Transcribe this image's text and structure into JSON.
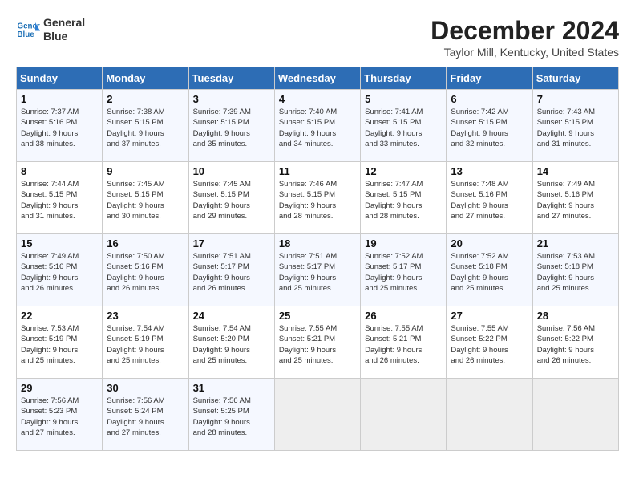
{
  "header": {
    "logo_line1": "General",
    "logo_line2": "Blue",
    "title": "December 2024",
    "subtitle": "Taylor Mill, Kentucky, United States"
  },
  "columns": [
    "Sunday",
    "Monday",
    "Tuesday",
    "Wednesday",
    "Thursday",
    "Friday",
    "Saturday"
  ],
  "weeks": [
    [
      {
        "day": "1",
        "info": "Sunrise: 7:37 AM\nSunset: 5:16 PM\nDaylight: 9 hours\nand 38 minutes."
      },
      {
        "day": "2",
        "info": "Sunrise: 7:38 AM\nSunset: 5:15 PM\nDaylight: 9 hours\nand 37 minutes."
      },
      {
        "day": "3",
        "info": "Sunrise: 7:39 AM\nSunset: 5:15 PM\nDaylight: 9 hours\nand 35 minutes."
      },
      {
        "day": "4",
        "info": "Sunrise: 7:40 AM\nSunset: 5:15 PM\nDaylight: 9 hours\nand 34 minutes."
      },
      {
        "day": "5",
        "info": "Sunrise: 7:41 AM\nSunset: 5:15 PM\nDaylight: 9 hours\nand 33 minutes."
      },
      {
        "day": "6",
        "info": "Sunrise: 7:42 AM\nSunset: 5:15 PM\nDaylight: 9 hours\nand 32 minutes."
      },
      {
        "day": "7",
        "info": "Sunrise: 7:43 AM\nSunset: 5:15 PM\nDaylight: 9 hours\nand 31 minutes."
      }
    ],
    [
      {
        "day": "8",
        "info": "Sunrise: 7:44 AM\nSunset: 5:15 PM\nDaylight: 9 hours\nand 31 minutes."
      },
      {
        "day": "9",
        "info": "Sunrise: 7:45 AM\nSunset: 5:15 PM\nDaylight: 9 hours\nand 30 minutes."
      },
      {
        "day": "10",
        "info": "Sunrise: 7:45 AM\nSunset: 5:15 PM\nDaylight: 9 hours\nand 29 minutes."
      },
      {
        "day": "11",
        "info": "Sunrise: 7:46 AM\nSunset: 5:15 PM\nDaylight: 9 hours\nand 28 minutes."
      },
      {
        "day": "12",
        "info": "Sunrise: 7:47 AM\nSunset: 5:15 PM\nDaylight: 9 hours\nand 28 minutes."
      },
      {
        "day": "13",
        "info": "Sunrise: 7:48 AM\nSunset: 5:16 PM\nDaylight: 9 hours\nand 27 minutes."
      },
      {
        "day": "14",
        "info": "Sunrise: 7:49 AM\nSunset: 5:16 PM\nDaylight: 9 hours\nand 27 minutes."
      }
    ],
    [
      {
        "day": "15",
        "info": "Sunrise: 7:49 AM\nSunset: 5:16 PM\nDaylight: 9 hours\nand 26 minutes."
      },
      {
        "day": "16",
        "info": "Sunrise: 7:50 AM\nSunset: 5:16 PM\nDaylight: 9 hours\nand 26 minutes."
      },
      {
        "day": "17",
        "info": "Sunrise: 7:51 AM\nSunset: 5:17 PM\nDaylight: 9 hours\nand 26 minutes."
      },
      {
        "day": "18",
        "info": "Sunrise: 7:51 AM\nSunset: 5:17 PM\nDaylight: 9 hours\nand 25 minutes."
      },
      {
        "day": "19",
        "info": "Sunrise: 7:52 AM\nSunset: 5:17 PM\nDaylight: 9 hours\nand 25 minutes."
      },
      {
        "day": "20",
        "info": "Sunrise: 7:52 AM\nSunset: 5:18 PM\nDaylight: 9 hours\nand 25 minutes."
      },
      {
        "day": "21",
        "info": "Sunrise: 7:53 AM\nSunset: 5:18 PM\nDaylight: 9 hours\nand 25 minutes."
      }
    ],
    [
      {
        "day": "22",
        "info": "Sunrise: 7:53 AM\nSunset: 5:19 PM\nDaylight: 9 hours\nand 25 minutes."
      },
      {
        "day": "23",
        "info": "Sunrise: 7:54 AM\nSunset: 5:19 PM\nDaylight: 9 hours\nand 25 minutes."
      },
      {
        "day": "24",
        "info": "Sunrise: 7:54 AM\nSunset: 5:20 PM\nDaylight: 9 hours\nand 25 minutes."
      },
      {
        "day": "25",
        "info": "Sunrise: 7:55 AM\nSunset: 5:21 PM\nDaylight: 9 hours\nand 25 minutes."
      },
      {
        "day": "26",
        "info": "Sunrise: 7:55 AM\nSunset: 5:21 PM\nDaylight: 9 hours\nand 26 minutes."
      },
      {
        "day": "27",
        "info": "Sunrise: 7:55 AM\nSunset: 5:22 PM\nDaylight: 9 hours\nand 26 minutes."
      },
      {
        "day": "28",
        "info": "Sunrise: 7:56 AM\nSunset: 5:22 PM\nDaylight: 9 hours\nand 26 minutes."
      }
    ],
    [
      {
        "day": "29",
        "info": "Sunrise: 7:56 AM\nSunset: 5:23 PM\nDaylight: 9 hours\nand 27 minutes."
      },
      {
        "day": "30",
        "info": "Sunrise: 7:56 AM\nSunset: 5:24 PM\nDaylight: 9 hours\nand 27 minutes."
      },
      {
        "day": "31",
        "info": "Sunrise: 7:56 AM\nSunset: 5:25 PM\nDaylight: 9 hours\nand 28 minutes."
      },
      null,
      null,
      null,
      null
    ]
  ]
}
